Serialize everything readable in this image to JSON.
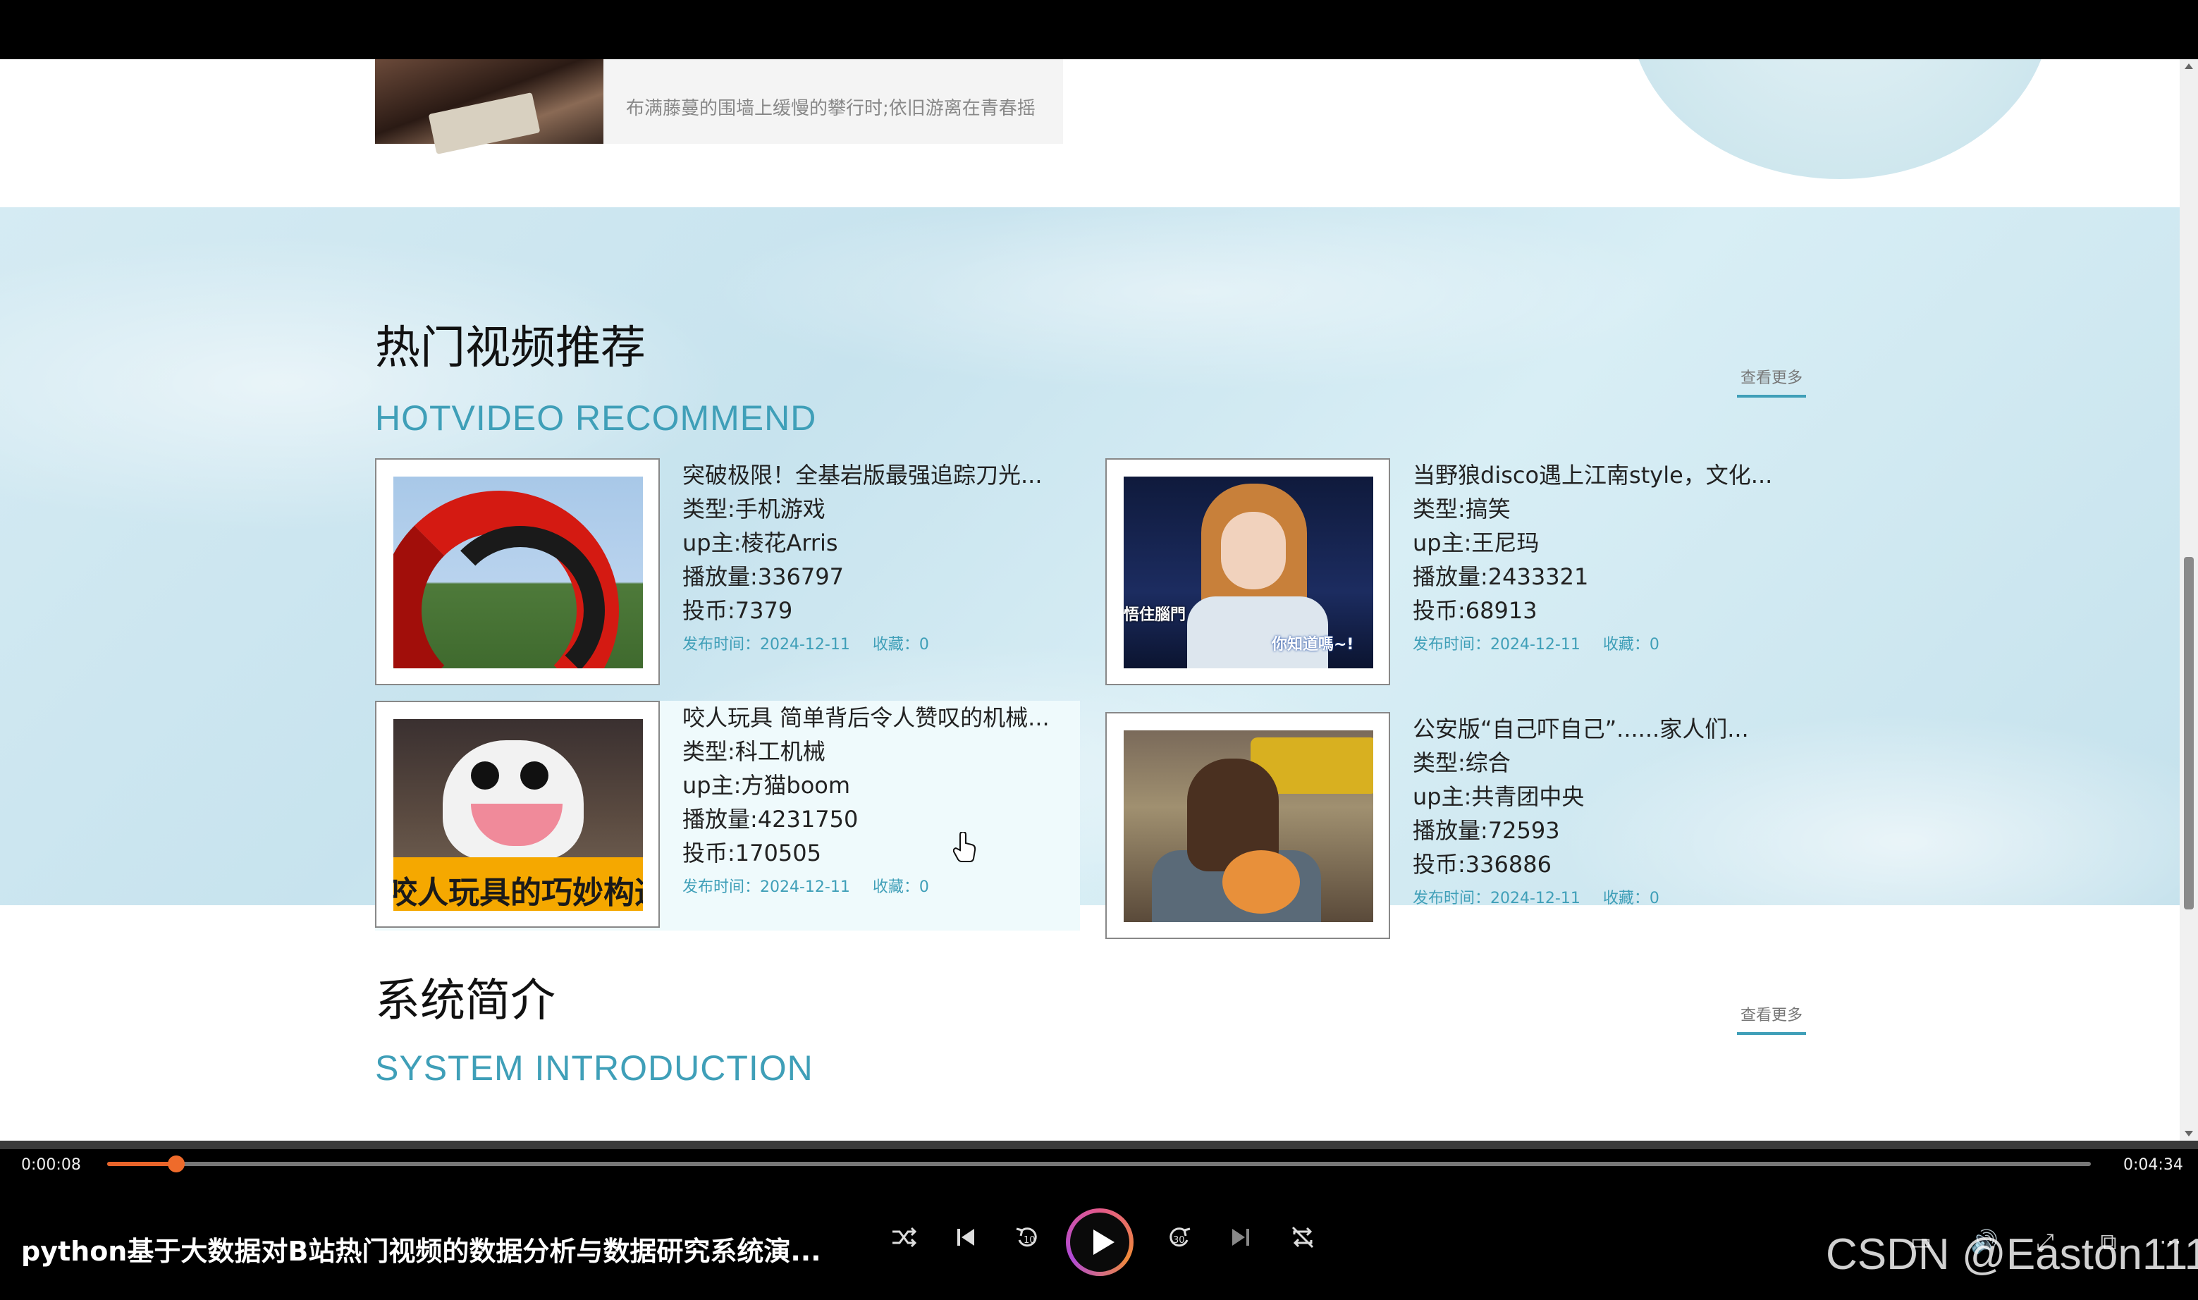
{
  "prev_card": {
    "text": "布满藤蔓的围墙上缓慢的攀行时;依旧游离在青春摇"
  },
  "hot_section": {
    "title": "热门视频推荐",
    "subtitle": "HOTVIDEO RECOMMEND",
    "more": "查看更多",
    "videos": [
      {
        "title": "突破极限！全基岩版最强追踪刀光...",
        "type": "类型:手机游戏",
        "up": "up主:棱花Arris",
        "plays": "播放量:336797",
        "coins": "投币:7379",
        "date": "发布时间：2024-12-11",
        "favs": "收藏：0"
      },
      {
        "title": "当野狼disco遇上江南style，文化...",
        "type": "类型:搞笑",
        "up": "up主:王尼玛",
        "plays": "播放量:2433321",
        "coins": "投币:68913",
        "date": "发布时间：2024-12-11",
        "favs": "收藏：0",
        "thumb_caption_left": "悟住腦門",
        "thumb_caption_right": "你知道嗎~!"
      },
      {
        "title": "咬人玩具 简单背后令人赞叹的机械...",
        "type": "类型:科工机械",
        "up": "up主:方猫boom",
        "plays": "播放量:4231750",
        "coins": "投币:170505",
        "date": "发布时间：2024-12-11",
        "favs": "收藏：0",
        "thumb_caption": "咬人玩具的巧妙构造"
      },
      {
        "title": "公安版“自己吓自己”......家人们...",
        "type": "类型:综合",
        "up": "up主:共青团中央",
        "plays": "播放量:72593",
        "coins": "投币:336886",
        "date": "发布时间：2024-12-11",
        "favs": "收藏：0"
      }
    ]
  },
  "intro_section": {
    "title": "系统简介",
    "subtitle": "SYSTEM INTRODUCTION",
    "more": "查看更多"
  },
  "player": {
    "current_time": "0:00:08",
    "total_time": "0:04:34",
    "progress": 0.035,
    "title": "python基于大数据对B站热门视频的数据分析与数据研究系统演...",
    "accent_color": "#e8642a"
  },
  "watermark": "CSDN @Easton111"
}
